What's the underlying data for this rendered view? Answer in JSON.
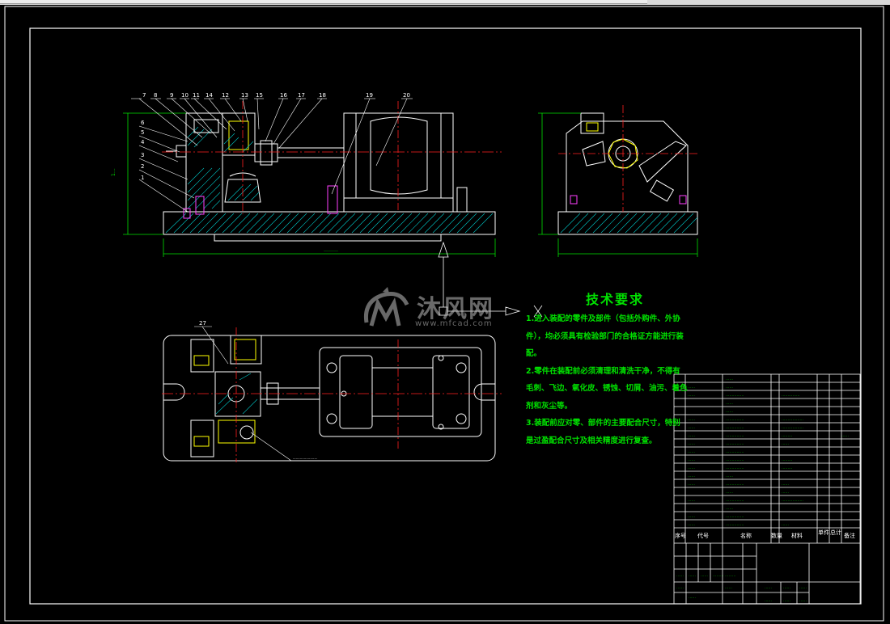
{
  "drawing": {
    "tech_requirements": {
      "title": "技术要求",
      "items": [
        "1.进入装配的零件及部件（包括外购件、外协件），均必须具有检验部门的合格证方能进行装配。",
        "2.零件在装配前必须清理和清洗干净，不得有毛刺、飞边、氧化皮、锈蚀、切屑、油污、着色剂和灰尘等。",
        "3.装配前应对零、部件的主要配合尺寸，特别是过盈配合尺寸及相关精度进行复查。"
      ]
    },
    "watermark": {
      "text_cn": "沐风网",
      "text_en": "www.mfcad.com"
    },
    "balloons": [
      "7",
      "8",
      "9",
      "10",
      "11",
      "14",
      "12",
      "13",
      "15",
      "16",
      "17",
      "18",
      "19",
      "20",
      "6",
      "5",
      "4",
      "3",
      "2",
      "1",
      "27"
    ],
    "bom_header": [
      "序号",
      "代号",
      "名称",
      "数量",
      "材料",
      "单件",
      "总计",
      "备注"
    ],
    "colors": {
      "frame": "#ffffff",
      "outline": "#ffffff",
      "center": "#ff2020",
      "dim": "#00e000",
      "hatch": "#00c8c8",
      "yellow": "#ffff00",
      "magenta": "#ff40ff",
      "text": "#00e000"
    }
  }
}
